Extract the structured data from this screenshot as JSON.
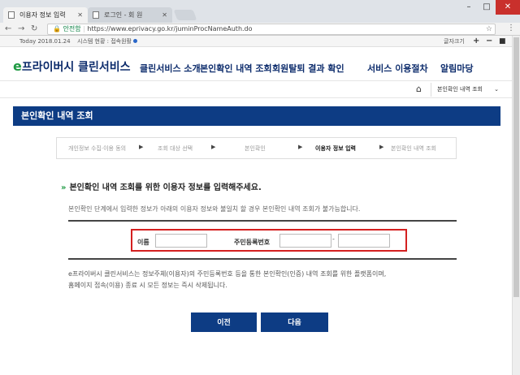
{
  "browser": {
    "tabs": [
      {
        "title": "이용자 정보 입력"
      },
      {
        "title": "로그인 - 회 원"
      }
    ],
    "address": {
      "secure_label": "안전함",
      "url": "https://www.eprivacy.go.kr/juminProcNameAuth.do"
    }
  },
  "utility": {
    "today": "Today 2018.01.24",
    "system_status": "시스템 현황 : 접속원활",
    "font_size_label": "글자크기"
  },
  "header": {
    "logo_e": "e",
    "logo_text": "프라이버시 클린서비스",
    "nav": [
      "클린서비스 소개",
      "본인확인 내역 조회",
      "회원탈퇴 결과 확인",
      "서비스 이용절차",
      "알림마당"
    ]
  },
  "location": {
    "current": "본인확인 내역 조회"
  },
  "page": {
    "title": "본인확인 내역 조회",
    "steps": [
      {
        "label": "개인정보 수집·이용 동의",
        "current": false
      },
      {
        "label": "조회 대상 선택",
        "current": false
      },
      {
        "label": "본인확인",
        "current": false
      },
      {
        "label": "이용자 정보 입력",
        "current": true
      },
      {
        "label": "본인확인 내역 조회",
        "current": false
      }
    ],
    "heading": "본인확인 내역 조회를 위한 이용자 정보를 입력해주세요.",
    "description": "본인확인 단계에서 입력한 정보가 아래의 이용자 정보와 불일치 할 경우 본인확인 내역 조회가 불가능합니다.",
    "form": {
      "name_label": "이름",
      "name_value": "",
      "rrn_label": "주민등록번호",
      "rrn_front_value": "",
      "rrn_separator": "-",
      "rrn_back_value": ""
    },
    "notice_line1": "e프라이버시 클린서비스는 정보주체(이용자)의 주민등록번호 등을 통한 본인확인(인증) 내역 조회를 위한 플랫폼이며,",
    "notice_line2": "홈페이지 접속(이용) 종료 시 모든 정보는 즉시 삭제됩니다.",
    "buttons": {
      "prev": "이전",
      "next": "다음"
    }
  }
}
